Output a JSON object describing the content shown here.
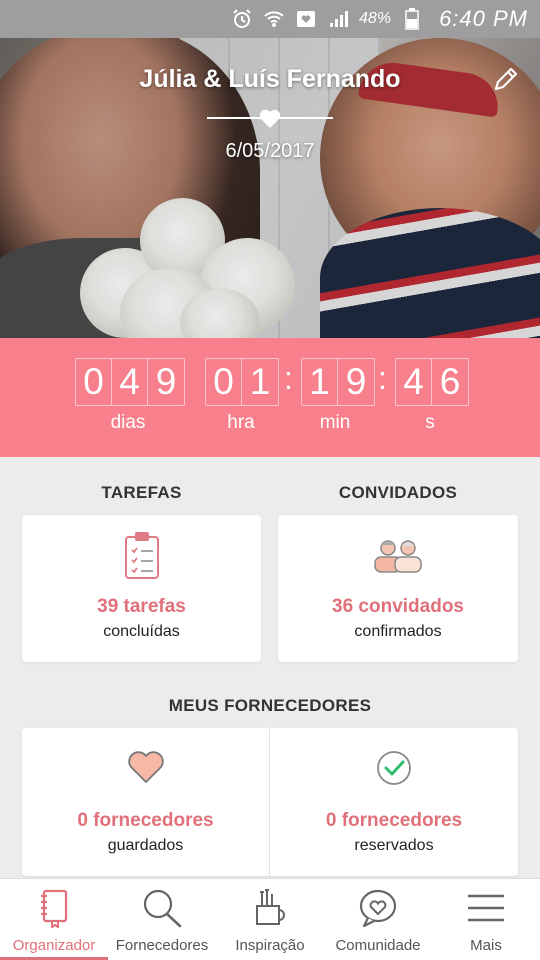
{
  "status_bar": {
    "battery_text": "48%",
    "time": "6:40 PM"
  },
  "hero": {
    "title": "Júlia & Luís Fernando",
    "date": "6/05/2017"
  },
  "countdown": {
    "days_digits": [
      "0",
      "4",
      "9"
    ],
    "hours_digits": [
      "0",
      "1"
    ],
    "minutes_digits": [
      "1",
      "9"
    ],
    "seconds_digits": [
      "4",
      "6"
    ],
    "separator": ":",
    "labels": {
      "days": "dias",
      "hours": "hra",
      "minutes": "min",
      "seconds": "s"
    }
  },
  "tasks": {
    "title": "TAREFAS",
    "count": "39 tarefas",
    "sub": "concluídas"
  },
  "guests": {
    "title": "CONVIDADOS",
    "count": "36 convidados",
    "sub": "confirmados"
  },
  "vendors": {
    "title": "MEUS FORNECEDORES",
    "saved_count": "0 fornecedores",
    "saved_sub": "guardados",
    "reserved_count": "0 fornecedores",
    "reserved_sub": "reservados"
  },
  "nav": [
    {
      "label": "Organizador",
      "icon": "notebook-icon",
      "active": true
    },
    {
      "label": "Fornecedores",
      "icon": "search-icon",
      "active": false
    },
    {
      "label": "Inspiração",
      "icon": "brush-cup-icon",
      "active": false
    },
    {
      "label": "Comunidade",
      "icon": "chat-heart-icon",
      "active": false
    },
    {
      "label": "Mais",
      "icon": "menu-icon",
      "active": false
    }
  ],
  "colors": {
    "accent": "#e0707a",
    "countdown_bg": "#f7808c",
    "status_bar": "#9e9e9e",
    "page_bg": "#ececec"
  }
}
